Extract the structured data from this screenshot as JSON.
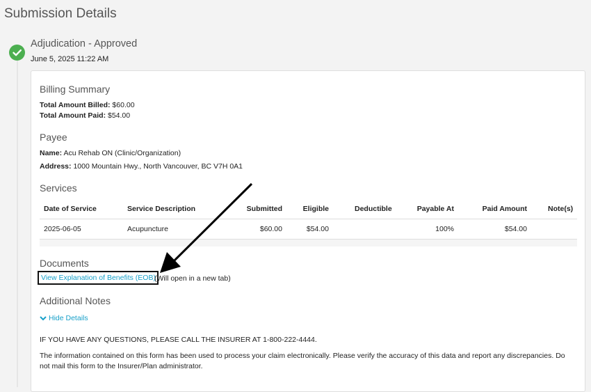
{
  "page": {
    "title": "Submission Details"
  },
  "status": {
    "title": "Adjudication - Approved",
    "date": "June 5, 2025 11:22 AM",
    "color": "#4caf50"
  },
  "billing": {
    "heading": "Billing Summary",
    "billed_label": "Total Amount Billed:",
    "billed_value": "$60.00",
    "paid_label": "Total Amount Paid:",
    "paid_value": "$54.00"
  },
  "payee": {
    "heading": "Payee",
    "name_label": "Name:",
    "name_value": "Acu Rehab ON (Clinic/Organization)",
    "address_label": "Address:",
    "address_value": "1000 Mountain Hwy., North Vancouver, BC V7H 0A1"
  },
  "services": {
    "heading": "Services",
    "columns": [
      "Date of Service",
      "Service Description",
      "Submitted",
      "Eligible",
      "Deductible",
      "Payable At",
      "Paid Amount",
      "Note(s)"
    ],
    "rows": [
      [
        "2025-06-05",
        "Acupuncture",
        "$60.00",
        "$54.00",
        "",
        "100%",
        "$54.00",
        ""
      ]
    ]
  },
  "documents": {
    "heading": "Documents",
    "link_label": "View Explanation of Benefits (EOB)",
    "link_note": "(Will open in a new tab)"
  },
  "notes": {
    "heading": "Additional Notes",
    "toggle_label": "Hide Details",
    "line1": "IF YOU HAVE ANY QUESTIONS, PLEASE CALL THE INSURER AT 1-800-222-4444.",
    "line2": "The information contained on this form has been used to process your claim electronically. Please verify the accuracy of this data and report any discrepancies. Do not mail this form to the Insurer/Plan administrator."
  },
  "colors": {
    "link": "#18a0c9",
    "accent_check": "#4caf50"
  }
}
